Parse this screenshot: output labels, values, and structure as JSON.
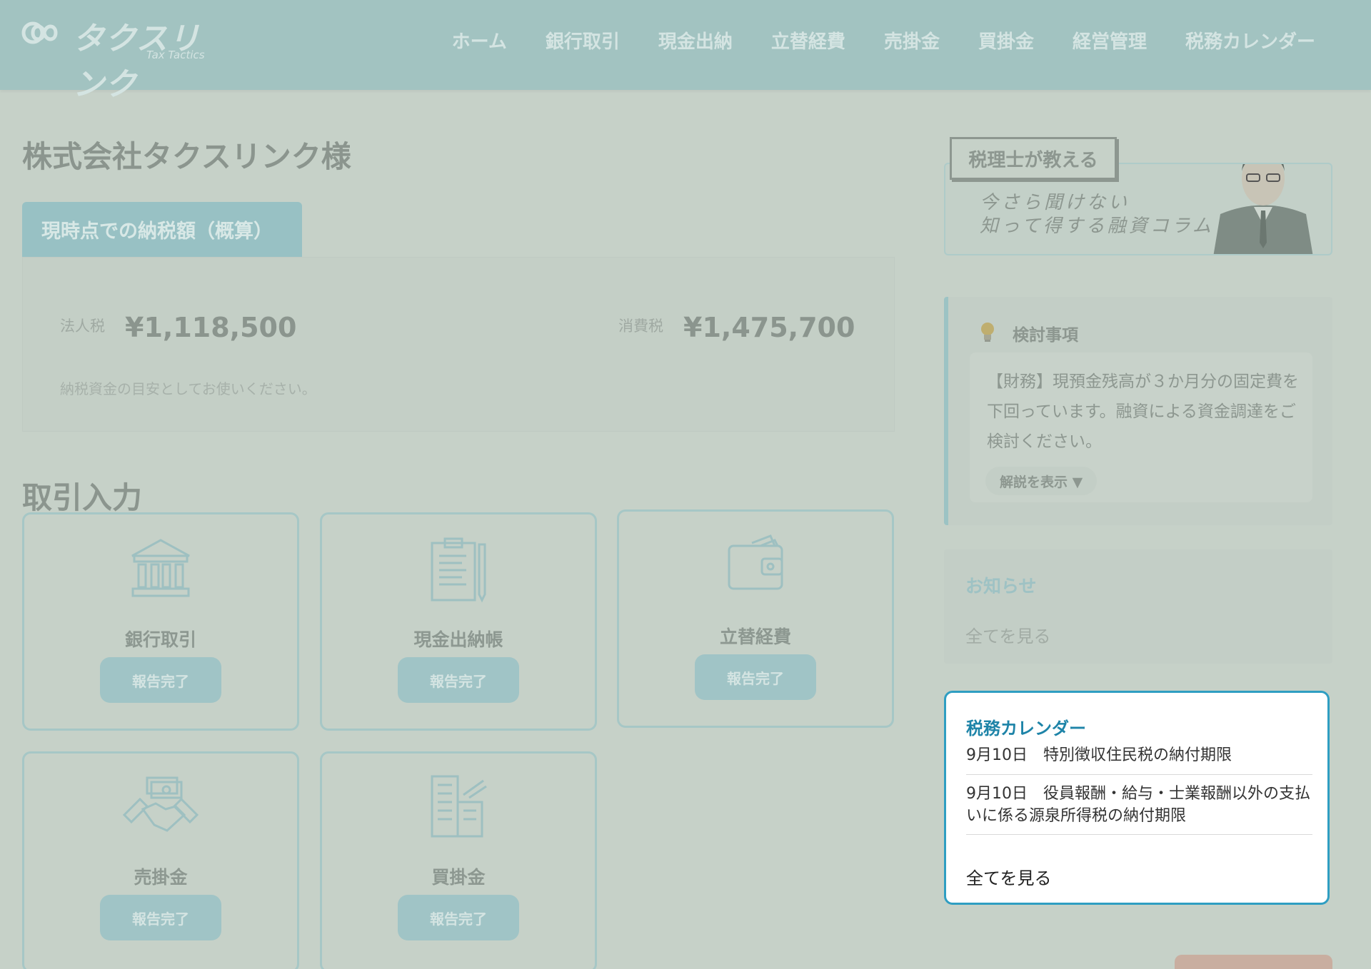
{
  "header": {
    "logo_text": "タクスリンク",
    "logo_sub": "Tax Tactics",
    "nav": [
      "ホーム",
      "銀行取引",
      "現金出納",
      "立替経費",
      "売掛金",
      "買掛金",
      "経営管理",
      "税務カレンダー"
    ]
  },
  "company_name": "株式会社タクスリンク様",
  "tax": {
    "tab_label": "現時点での納税額（概算）",
    "corporate_label": "法人税",
    "corporate_amount": "¥1,118,500",
    "consumption_label": "消費税",
    "consumption_amount": "¥1,475,700",
    "note": "納税資金の目安としてお使いください。"
  },
  "transactions": {
    "title": "取引入力",
    "cards": [
      {
        "label": "銀行取引",
        "button": "報告完了",
        "icon": "bank-icon"
      },
      {
        "label": "現金出納帳",
        "button": "報告完了",
        "icon": "clipboard-icon"
      },
      {
        "label": "立替経費",
        "button": "報告完了",
        "icon": "wallet-icon"
      },
      {
        "label": "売掛金",
        "button": "報告完了",
        "icon": "handshake-icon"
      },
      {
        "label": "買掛金",
        "button": "報告完了",
        "icon": "building-icon"
      }
    ]
  },
  "banner": {
    "speech": "税理士が教える",
    "line1": "今さら聞けない",
    "line2": "知って得する融資コラム"
  },
  "consider": {
    "title": "検討事項",
    "text": "【財務】現預金残高が３か月分の固定費を下回っています。融資による資金調達をご検討ください。",
    "explain_button": "解説を表示 ▼"
  },
  "notice": {
    "title": "お知らせ",
    "link": "全てを見る"
  },
  "calendar": {
    "title": "税務カレンダー",
    "items": [
      "9月10日　特別徴収住民税の納付期限",
      "9月10日　役員報酬・給与・士業報酬以外の支払いに係る源泉所得税の納付期限"
    ],
    "link": "全てを見る"
  },
  "colors": {
    "header_bg": "#a2c3c1",
    "page_bg": "#c6d1c8",
    "accent": "#2f9ec2",
    "calendar_title": "#1e84a8"
  }
}
